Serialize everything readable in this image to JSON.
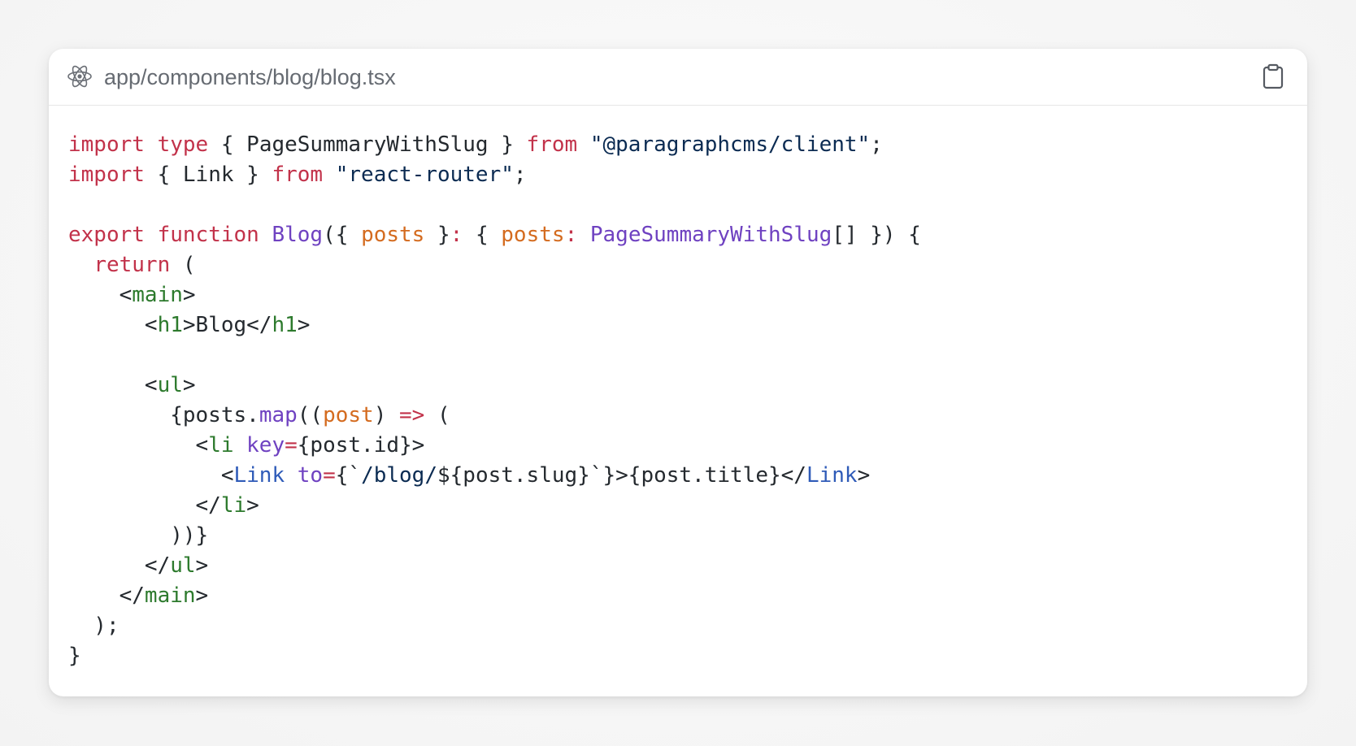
{
  "header": {
    "filename": "app/components/blog/blog.tsx",
    "file_icon": "react-icon",
    "copy_icon": "clipboard-icon"
  },
  "colors": {
    "keyword": "#c2324a",
    "string": "#0b2b52",
    "function": "#6f42c1",
    "param": "#d46b1f",
    "tag": "#2d7a2d",
    "component": "#2f5bb8",
    "plain": "#24292e",
    "filename": "#666b72"
  },
  "code": {
    "lines": [
      [
        {
          "t": "import",
          "c": "kw"
        },
        {
          "t": " ",
          "c": "plain"
        },
        {
          "t": "type",
          "c": "kw"
        },
        {
          "t": " { PageSummaryWithSlug } ",
          "c": "plain"
        },
        {
          "t": "from",
          "c": "kw"
        },
        {
          "t": " ",
          "c": "plain"
        },
        {
          "t": "\"@paragraphcms/client\"",
          "c": "str"
        },
        {
          "t": ";",
          "c": "plain"
        }
      ],
      [
        {
          "t": "import",
          "c": "kw"
        },
        {
          "t": " { Link } ",
          "c": "plain"
        },
        {
          "t": "from",
          "c": "kw"
        },
        {
          "t": " ",
          "c": "plain"
        },
        {
          "t": "\"react-router\"",
          "c": "str"
        },
        {
          "t": ";",
          "c": "plain"
        }
      ],
      [],
      [
        {
          "t": "export",
          "c": "kw"
        },
        {
          "t": " ",
          "c": "plain"
        },
        {
          "t": "function",
          "c": "kw"
        },
        {
          "t": " ",
          "c": "plain"
        },
        {
          "t": "Blog",
          "c": "fn"
        },
        {
          "t": "({ ",
          "c": "plain"
        },
        {
          "t": "posts",
          "c": "param"
        },
        {
          "t": " }",
          "c": "plain"
        },
        {
          "t": ":",
          "c": "kw"
        },
        {
          "t": " { ",
          "c": "plain"
        },
        {
          "t": "posts",
          "c": "param"
        },
        {
          "t": ":",
          "c": "kw"
        },
        {
          "t": " ",
          "c": "plain"
        },
        {
          "t": "PageSummaryWithSlug",
          "c": "type"
        },
        {
          "t": "[] }) {",
          "c": "plain"
        }
      ],
      [
        {
          "t": "  ",
          "c": "plain"
        },
        {
          "t": "return",
          "c": "kw"
        },
        {
          "t": " (",
          "c": "plain"
        }
      ],
      [
        {
          "t": "    <",
          "c": "plain"
        },
        {
          "t": "main",
          "c": "tag"
        },
        {
          "t": ">",
          "c": "plain"
        }
      ],
      [
        {
          "t": "      <",
          "c": "plain"
        },
        {
          "t": "h1",
          "c": "tag"
        },
        {
          "t": ">Blog</",
          "c": "plain"
        },
        {
          "t": "h1",
          "c": "tag"
        },
        {
          "t": ">",
          "c": "plain"
        }
      ],
      [],
      [
        {
          "t": "      <",
          "c": "plain"
        },
        {
          "t": "ul",
          "c": "tag"
        },
        {
          "t": ">",
          "c": "plain"
        }
      ],
      [
        {
          "t": "        {posts.",
          "c": "plain"
        },
        {
          "t": "map",
          "c": "fn"
        },
        {
          "t": "((",
          "c": "plain"
        },
        {
          "t": "post",
          "c": "param"
        },
        {
          "t": ") ",
          "c": "plain"
        },
        {
          "t": "=>",
          "c": "op"
        },
        {
          "t": " (",
          "c": "plain"
        }
      ],
      [
        {
          "t": "          <",
          "c": "plain"
        },
        {
          "t": "li",
          "c": "tag"
        },
        {
          "t": " ",
          "c": "plain"
        },
        {
          "t": "key",
          "c": "attr"
        },
        {
          "t": "=",
          "c": "op"
        },
        {
          "t": "{post.id}>",
          "c": "plain"
        }
      ],
      [
        {
          "t": "            <",
          "c": "plain"
        },
        {
          "t": "Link",
          "c": "comp"
        },
        {
          "t": " ",
          "c": "plain"
        },
        {
          "t": "to",
          "c": "attr"
        },
        {
          "t": "=",
          "c": "op"
        },
        {
          "t": "{`",
          "c": "plain"
        },
        {
          "t": "/blog/",
          "c": "str"
        },
        {
          "t": "${post.slug}`}>{post.title}</",
          "c": "plain"
        },
        {
          "t": "Link",
          "c": "comp"
        },
        {
          "t": ">",
          "c": "plain"
        }
      ],
      [
        {
          "t": "          </",
          "c": "plain"
        },
        {
          "t": "li",
          "c": "tag"
        },
        {
          "t": ">",
          "c": "plain"
        }
      ],
      [
        {
          "t": "        ))}",
          "c": "plain"
        }
      ],
      [
        {
          "t": "      </",
          "c": "plain"
        },
        {
          "t": "ul",
          "c": "tag"
        },
        {
          "t": ">",
          "c": "plain"
        }
      ],
      [
        {
          "t": "    </",
          "c": "plain"
        },
        {
          "t": "main",
          "c": "tag"
        },
        {
          "t": ">",
          "c": "plain"
        }
      ],
      [
        {
          "t": "  );",
          "c": "plain"
        }
      ],
      [
        {
          "t": "}",
          "c": "plain"
        }
      ]
    ]
  }
}
